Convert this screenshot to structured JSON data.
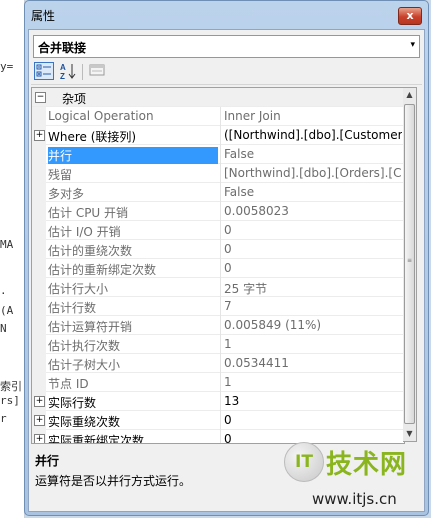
{
  "window": {
    "title": "属性",
    "close_glyph": "x"
  },
  "object_selector": {
    "value": "合并联接",
    "arrow": "▾"
  },
  "toolbar": {
    "alpha_glyph": "A↓Z"
  },
  "category": {
    "label": "杂项",
    "expander": "⊟"
  },
  "rows": [
    {
      "name": "Logical Operation",
      "value": "Inner Join",
      "bold": false,
      "expander": ""
    },
    {
      "name": "Where (联接列)",
      "value": "([Northwind].[dbo].[Customers]",
      "bold": true,
      "expander": "+"
    },
    {
      "name": "并行",
      "value": "False",
      "bold": false,
      "expander": "",
      "selected": true
    },
    {
      "name": "残留",
      "value": "[Northwind].[dbo].[Orders].[Cu",
      "bold": false,
      "expander": ""
    },
    {
      "name": "多对多",
      "value": "False",
      "bold": false,
      "expander": ""
    },
    {
      "name": "估计 CPU 开销",
      "value": "0.0058023",
      "bold": false,
      "expander": ""
    },
    {
      "name": "估计 I/O 开销",
      "value": "0",
      "bold": false,
      "expander": ""
    },
    {
      "name": "估计的重绕次数",
      "value": "0",
      "bold": false,
      "expander": ""
    },
    {
      "name": "估计的重新绑定次数",
      "value": "0",
      "bold": false,
      "expander": ""
    },
    {
      "name": "估计行大小",
      "value": "25 字节",
      "bold": false,
      "expander": ""
    },
    {
      "name": "估计行数",
      "value": "7",
      "bold": false,
      "expander": ""
    },
    {
      "name": "估计运算符开销",
      "value": "0.005849 (11%)",
      "bold": false,
      "expander": ""
    },
    {
      "name": "估计执行次数",
      "value": "1",
      "bold": false,
      "expander": ""
    },
    {
      "name": "估计子树大小",
      "value": "0.0534411",
      "bold": false,
      "expander": ""
    },
    {
      "name": "节点 ID",
      "value": "1",
      "bold": false,
      "expander": ""
    },
    {
      "name": "实际行数",
      "value": "13",
      "bold": true,
      "expander": "+"
    },
    {
      "name": "实际重绕次数",
      "value": "0",
      "bold": true,
      "expander": "+"
    },
    {
      "name": "实际重新绑定次数",
      "value": "0",
      "bold": true,
      "expander": "+"
    }
  ],
  "scrollbar": {
    "up": "▲",
    "down": "▼"
  },
  "description": {
    "title": "并行",
    "text": "运算符是否以并行方式运行。"
  },
  "background_code": [
    "y=",
    "MA",
    ".",
    "(A",
    "N",
    "索引",
    "rs]",
    "r"
  ],
  "watermark": {
    "logo": "IT",
    "name": "技术网",
    "url": "www.itjs.cn"
  },
  "colors": {
    "selection": "#3399ff",
    "window_frame": "#a9c3e0",
    "close": "#c9412b",
    "watermark": "#8bb51e"
  }
}
